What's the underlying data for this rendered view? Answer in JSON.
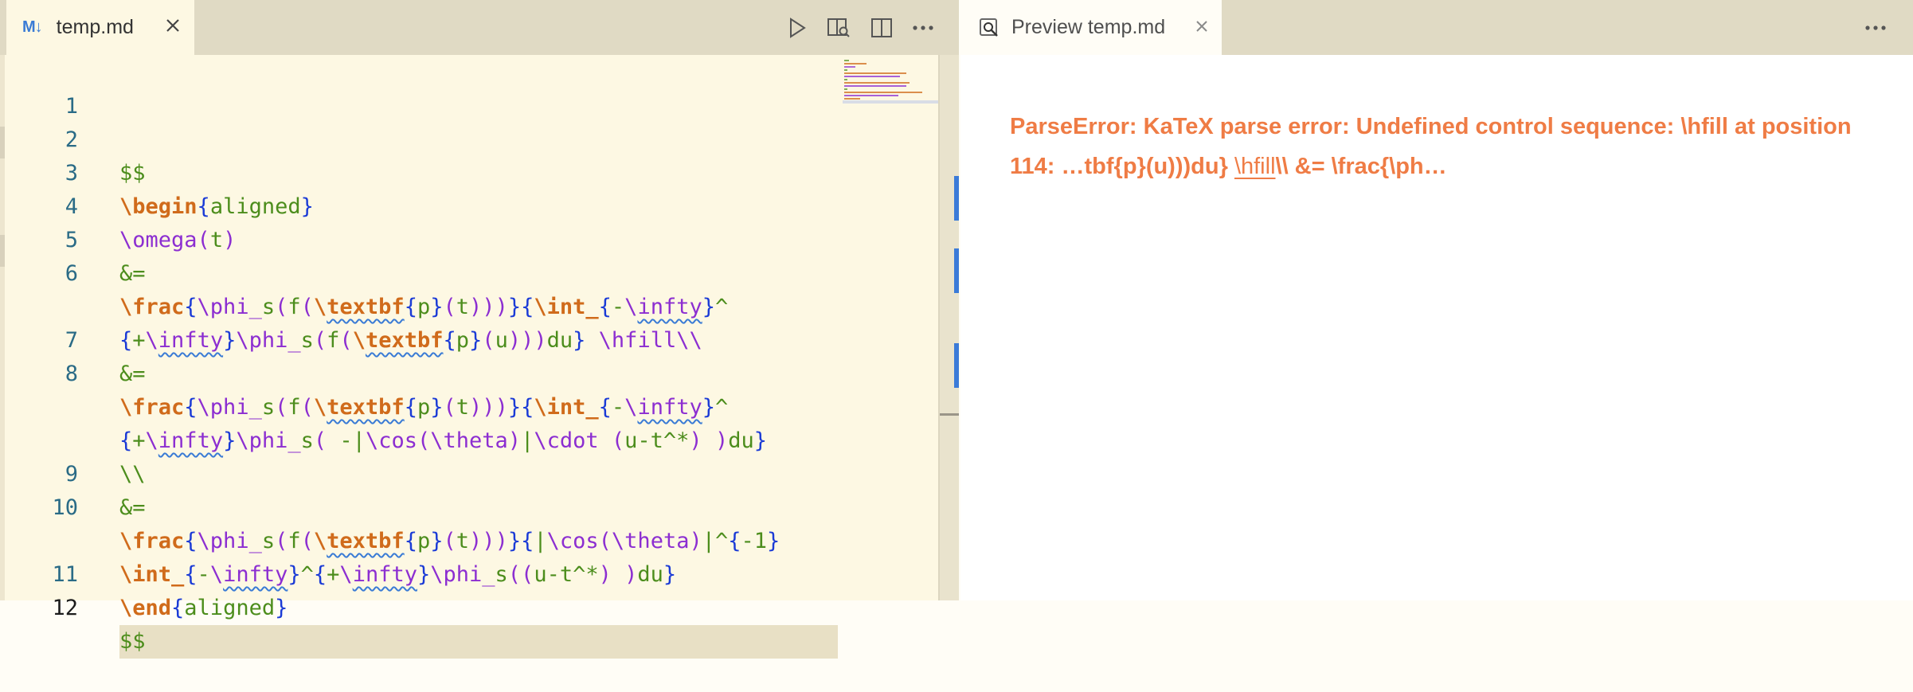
{
  "editor": {
    "tab_label": "temp.md",
    "tab_icon": "markdown-icon",
    "tab_icon_text": "M↓",
    "toolbar": [
      "run-icon",
      "open-preview-icon",
      "split-editor-icon",
      "more-actions-icon"
    ],
    "current_line": 12,
    "lines": [
      {
        "number": "1",
        "text": ""
      },
      {
        "number": "2",
        "text": "$$"
      },
      {
        "number": "3",
        "text": "\\begin{aligned}"
      },
      {
        "number": "4",
        "text": "\\omega(t)"
      },
      {
        "number": "5",
        "text": "&="
      },
      {
        "number": "6",
        "text": "\\frac{\\phi_s(f(\\textbf{p}(t)))}{\\int_{-\\infty}^"
      },
      {
        "number": "",
        "text": "{+\\infty}\\phi_s(f(\\textbf{p}(u)))du} \\hfill\\\\"
      },
      {
        "number": "7",
        "text": "&="
      },
      {
        "number": "8",
        "text": "\\frac{\\phi_s(f(\\textbf{p}(t)))}{\\int_{-\\infty}^"
      },
      {
        "number": "",
        "text": "{+\\infty}\\phi_s( -|\\cos(\\theta)|\\cdot (u-t^*) )du}"
      },
      {
        "number": "",
        "text": "\\\\"
      },
      {
        "number": "9",
        "text": "&="
      },
      {
        "number": "10",
        "text": "\\frac{\\phi_s(f(\\textbf{p}(t)))}{|\\cos(\\theta)|^{-1}"
      },
      {
        "number": "",
        "text": "\\int_{-\\infty}^{+\\infty}\\phi_s((u-t^*) )du}"
      },
      {
        "number": "11",
        "text": "\\end{aligned}"
      },
      {
        "number": "12",
        "text": "$$"
      }
    ]
  },
  "preview": {
    "tab_label": "Preview temp.md",
    "tab_icon": "preview-icon",
    "error_message": "ParseError: KaTeX parse error: Undefined control sequence: \\hfill at position 114: …tbf{p}(u)))du} ",
    "error_token": "\\hfill",
    "error_suffix": "\\\\ &= \\frac{\\ph…",
    "more_icon": "more-actions-icon"
  },
  "colors": {
    "editor_bg": "#fdf8e3",
    "tab_bar_bg": "#e0dac4",
    "error_text": "#ef7c45",
    "keyword": "#d06b1b",
    "command": "#8c2ed1",
    "brace": "#1b3bd6",
    "text": "#4c8d1c",
    "line_number": "#2a6b86",
    "accent": "#3b7bd8"
  }
}
